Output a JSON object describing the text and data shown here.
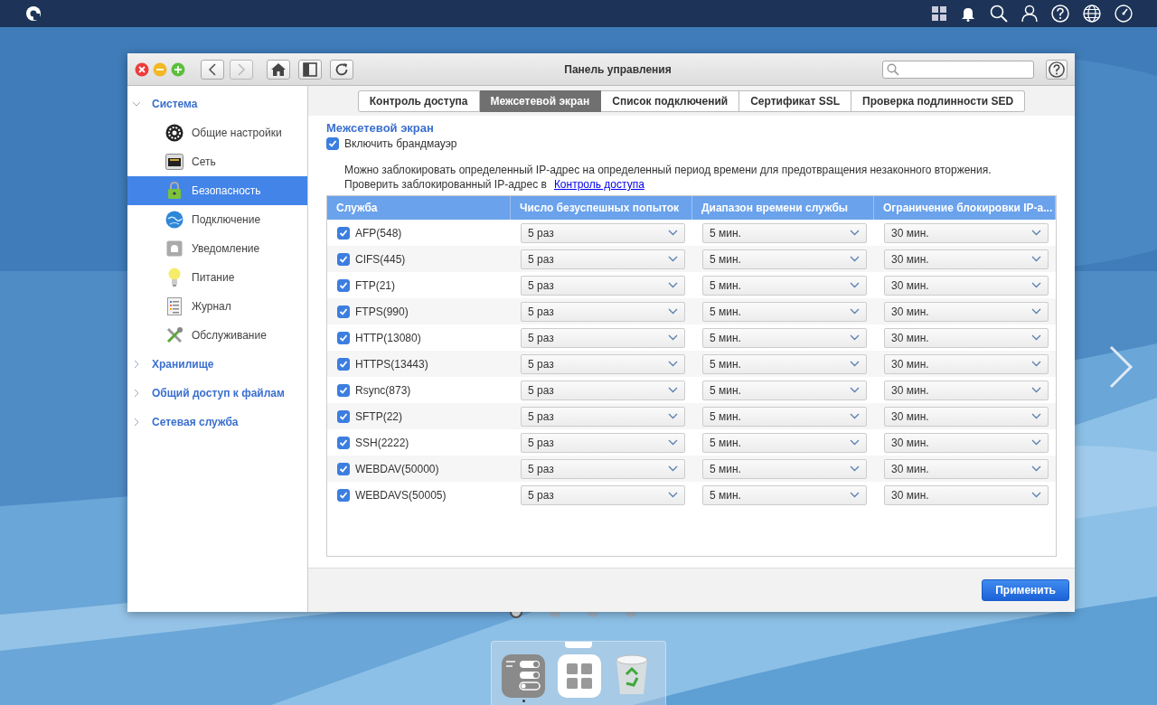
{
  "window": {
    "title": "Панель управления"
  },
  "sidebar": {
    "groups": [
      {
        "label": "Система",
        "expanded": true,
        "children": [
          {
            "label": "Общие настройки",
            "selected": false
          },
          {
            "label": "Сеть",
            "selected": false
          },
          {
            "label": "Безопасность",
            "selected": true
          },
          {
            "label": "Подключение",
            "selected": false
          },
          {
            "label": "Уведомление",
            "selected": false
          },
          {
            "label": "Питание",
            "selected": false
          },
          {
            "label": "Журнал",
            "selected": false
          },
          {
            "label": "Обслуживание",
            "selected": false
          }
        ]
      },
      {
        "label": "Хранилище",
        "expanded": false
      },
      {
        "label": "Общий доступ к файлам",
        "expanded": false
      },
      {
        "label": "Сетевая служба",
        "expanded": false
      }
    ]
  },
  "tabs": [
    {
      "label": "Контроль доступа",
      "selected": false
    },
    {
      "label": "Межсетевой экран",
      "selected": true
    },
    {
      "label": "Список подключений",
      "selected": false
    },
    {
      "label": "Сертификат SSL",
      "selected": false
    },
    {
      "label": "Проверка подлинности SED",
      "selected": false
    }
  ],
  "section_title": "Межсетевой экран",
  "enable_firewall": {
    "label": "Включить брандмауэр",
    "checked": true
  },
  "description": "Можно заблокировать определенный IP-адрес на определенный период времени для предотвращения незаконного вторжения.",
  "check_text": "Проверить заблокированный IP-адрес в",
  "check_link": "Контроль доступа",
  "table": {
    "columns": [
      "Служба",
      "Число безуспешных попыток",
      "Диапазон времени службы",
      "Ограничение блокировки IP-а..."
    ],
    "rows": [
      {
        "service": "AFP(548)",
        "checked": true,
        "attempts": "5 раз",
        "range": "5 мин.",
        "block": "30 мин."
      },
      {
        "service": "CIFS(445)",
        "checked": true,
        "attempts": "5 раз",
        "range": "5 мин.",
        "block": "30 мин."
      },
      {
        "service": "FTP(21)",
        "checked": true,
        "attempts": "5 раз",
        "range": "5 мин.",
        "block": "30 мин."
      },
      {
        "service": "FTPS(990)",
        "checked": true,
        "attempts": "5 раз",
        "range": "5 мин.",
        "block": "30 мин."
      },
      {
        "service": "HTTP(13080)",
        "checked": true,
        "attempts": "5 раз",
        "range": "5 мин.",
        "block": "30 мин."
      },
      {
        "service": "HTTPS(13443)",
        "checked": true,
        "attempts": "5 раз",
        "range": "5 мин.",
        "block": "30 мин."
      },
      {
        "service": "Rsync(873)",
        "checked": true,
        "attempts": "5 раз",
        "range": "5 мин.",
        "block": "30 мин."
      },
      {
        "service": "SFTP(22)",
        "checked": true,
        "attempts": "5 раз",
        "range": "5 мин.",
        "block": "30 мин."
      },
      {
        "service": "SSH(2222)",
        "checked": true,
        "attempts": "5 раз",
        "range": "5 мин.",
        "block": "30 мин."
      },
      {
        "service": "WEBDAV(50000)",
        "checked": true,
        "attempts": "5 раз",
        "range": "5 мин.",
        "block": "30 мин."
      },
      {
        "service": "WEBDAVS(50005)",
        "checked": true,
        "attempts": "5 раз",
        "range": "5 мин.",
        "block": "30 мин."
      }
    ]
  },
  "apply_button": "Применить",
  "pages": [
    {
      "selected": true
    },
    {
      "selected": false
    },
    {
      "selected": false
    },
    {
      "selected": false
    }
  ]
}
